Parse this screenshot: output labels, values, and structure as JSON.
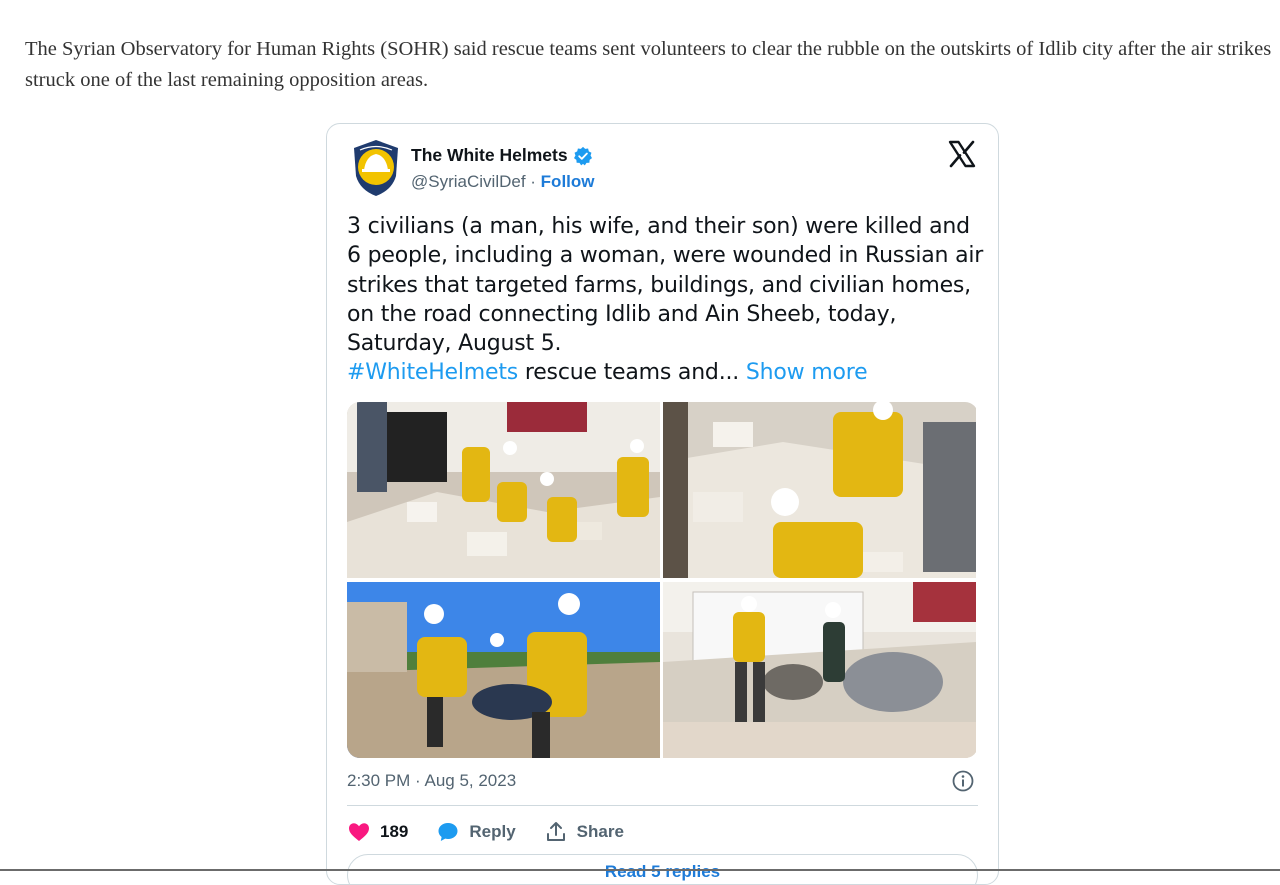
{
  "article": {
    "paragraph": "The Syrian Observatory for Human Rights (SOHR) said rescue teams sent volunteers to clear the rubble on the outskirts of Idlib city after the air strikes struck one of the last remaining opposition areas."
  },
  "tweet": {
    "author_name": "The White Helmets",
    "handle": "@SyriaCivilDef",
    "separator": " · ",
    "follow_label": "Follow",
    "text_main": "3 civilians (a man, his wife, and their son) were killed and 6 people, including a woman, were wounded in Russian air strikes that targeted farms, buildings, and civilian homes, on the road connecting Idlib and Ain Sheeb, today, Saturday, August 5.",
    "hashtag": "#WhiteHelmets",
    "text_trailing": " rescue teams and... ",
    "show_more": "Show more",
    "timestamp": "2:30 PM · Aug 5, 2023",
    "likes_count": "189",
    "reply_label": "Reply",
    "share_label": "Share",
    "read_replies_label": "Read 5 replies",
    "photos_count": 4
  },
  "icons": {
    "avatar": "white-helmets-logo",
    "verified": "verified-badge-icon",
    "platform": "x-logo-icon",
    "info": "info-icon",
    "like": "heart-icon",
    "reply": "speech-bubble-icon",
    "share": "share-upload-icon"
  },
  "colors": {
    "link": "#1d9bf0",
    "follow": "#1d7bd8",
    "like": "#f91880",
    "text": "#0f1419",
    "muted": "#536471",
    "border": "#cfd9de"
  }
}
